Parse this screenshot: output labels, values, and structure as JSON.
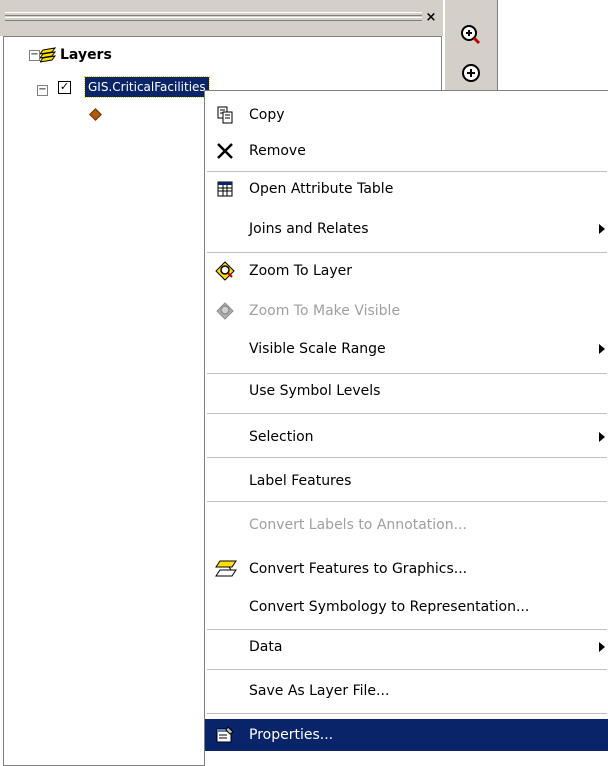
{
  "toc": {
    "close_glyph": "×",
    "root_label": "Layers",
    "root_expander": "−",
    "layer_expander": "−",
    "layer_checked": "✓",
    "layer_name": "GIS.CriticalFacilities"
  },
  "toolbar": {
    "buttons": [
      "zoom-in-icon",
      "fixed-zoom-in-icon"
    ]
  },
  "context_menu": {
    "items": [
      {
        "label": "Copy",
        "icon": "copy-icon",
        "enabled": true,
        "submenu": false
      },
      {
        "label": "Remove",
        "icon": "remove-icon",
        "enabled": true,
        "submenu": false
      },
      {
        "label": "Open Attribute Table",
        "icon": "table-icon",
        "enabled": true,
        "submenu": false
      },
      {
        "label": "Joins and Relates",
        "icon": "",
        "enabled": true,
        "submenu": true
      },
      {
        "label": "Zoom To Layer",
        "icon": "zoom-to-layer-icon",
        "enabled": true,
        "submenu": false
      },
      {
        "label": "Zoom To Make Visible",
        "icon": "zoom-to-make-visible-icon",
        "enabled": false,
        "submenu": false
      },
      {
        "label": "Visible Scale Range",
        "icon": "",
        "enabled": true,
        "submenu": true
      },
      {
        "label": "Use Symbol Levels",
        "icon": "",
        "enabled": true,
        "submenu": false
      },
      {
        "label": "Selection",
        "icon": "",
        "enabled": true,
        "submenu": true
      },
      {
        "label": "Label Features",
        "icon": "",
        "enabled": true,
        "submenu": false
      },
      {
        "label": "Convert Labels to Annotation...",
        "icon": "",
        "enabled": false,
        "submenu": false
      },
      {
        "label": "Convert Features to Graphics...",
        "icon": "convert-graphics-icon",
        "enabled": true,
        "submenu": false
      },
      {
        "label": "Convert Symbology to Representation...",
        "icon": "",
        "enabled": true,
        "submenu": false
      },
      {
        "label": "Data",
        "icon": "",
        "enabled": true,
        "submenu": true
      },
      {
        "label": "Save As Layer File...",
        "icon": "",
        "enabled": true,
        "submenu": false
      },
      {
        "label": "Properties...",
        "icon": "properties-icon",
        "enabled": true,
        "submenu": false,
        "selected": true
      }
    ]
  },
  "colors": {
    "selection": "#0a246a",
    "chrome": "#d4d0c8",
    "disabled_text": "#a0a0a0"
  }
}
